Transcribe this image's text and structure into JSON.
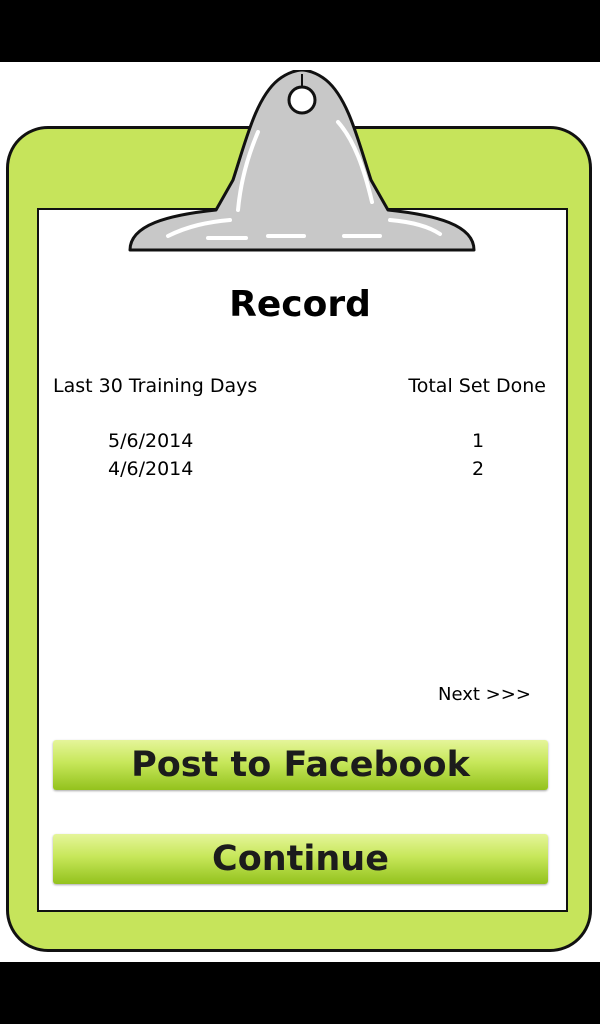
{
  "header": {
    "title": "Record"
  },
  "table": {
    "columns": [
      "Last 30 Training Days",
      "Total Set Done"
    ],
    "rows": [
      {
        "date": "5/6/2014",
        "sets": "1"
      },
      {
        "date": "4/6/2014",
        "sets": "2"
      }
    ]
  },
  "pagination": {
    "next_label": "Next >>>"
  },
  "actions": {
    "facebook_label": "Post to Facebook",
    "continue_label": "Continue"
  },
  "colors": {
    "board_green": "#c6e45b",
    "button_green_light": "#e5f59a",
    "button_green_dark": "#93c21d",
    "clip_gray": "#c8c8c8"
  },
  "icons": {
    "clip": "clipboard-clip-icon"
  }
}
